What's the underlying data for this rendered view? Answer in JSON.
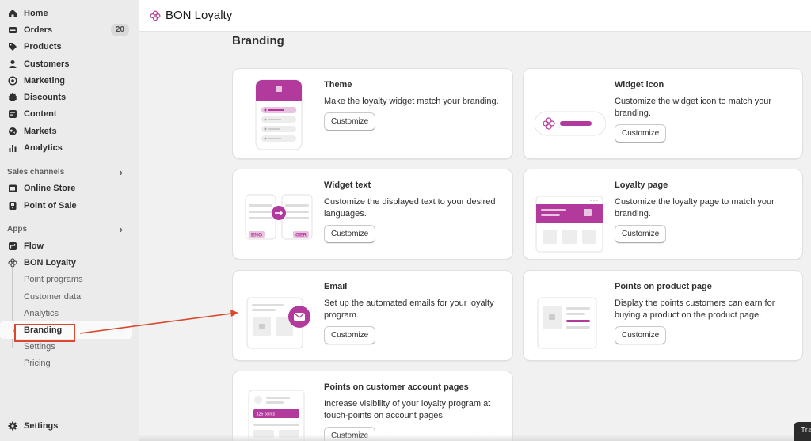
{
  "sidebar": {
    "items": [
      {
        "label": "Home",
        "icon": "home-icon"
      },
      {
        "label": "Orders",
        "icon": "orders-icon",
        "badge": "20"
      },
      {
        "label": "Products",
        "icon": "tag-icon"
      },
      {
        "label": "Customers",
        "icon": "person-icon"
      },
      {
        "label": "Marketing",
        "icon": "target-icon"
      },
      {
        "label": "Discounts",
        "icon": "discount-icon"
      },
      {
        "label": "Content",
        "icon": "content-icon"
      },
      {
        "label": "Markets",
        "icon": "globe-icon"
      },
      {
        "label": "Analytics",
        "icon": "bar-chart-icon"
      }
    ],
    "sales_channels": {
      "heading": "Sales channels",
      "items": [
        {
          "label": "Online Store",
          "icon": "store-icon"
        },
        {
          "label": "Point of Sale",
          "icon": "pos-icon"
        }
      ]
    },
    "apps": {
      "heading": "Apps",
      "items": [
        {
          "label": "Flow",
          "icon": "flow-icon"
        },
        {
          "label": "BON Loyalty",
          "icon": "flower-icon"
        }
      ],
      "sub_items": [
        "Point programs",
        "Customer data",
        "Analytics",
        "Branding",
        "Settings",
        "Pricing"
      ],
      "active_sub": "Branding"
    },
    "settings_label": "Settings"
  },
  "header": {
    "app_title": "BON Loyalty"
  },
  "main": {
    "title": "Branding",
    "cards": [
      {
        "title": "Theme",
        "description": "Make the loyalty widget match your branding.",
        "button": "Customize"
      },
      {
        "title": "Widget icon",
        "description": "Customize the widget icon to match your branding.",
        "button": "Customize"
      },
      {
        "title": "Widget text",
        "description": "Customize the displayed text to your desired languages.",
        "button": "Customize",
        "thumb_labels": [
          "ENG",
          "GER"
        ]
      },
      {
        "title": "Loyalty page",
        "description": "Customize the loyalty page to match your branding.",
        "button": "Customize"
      },
      {
        "title": "Email",
        "description": "Set up the automated emails for your loyalty program.",
        "button": "Customize"
      },
      {
        "title": "Points on product page",
        "description": "Display the points customers can earn for buying a product on the product page.",
        "button": "Customize"
      },
      {
        "title": "Points on customer account pages",
        "description": "Increase visibility of your loyalty program at touch-points on account pages.",
        "button": "Customize",
        "thumb_label": "125 points"
      }
    ]
  },
  "tray_text": "Tra",
  "colors": {
    "accent": "#b23a9c",
    "accent_light": "#e8c4e0",
    "annotation_red": "#d9482f"
  }
}
